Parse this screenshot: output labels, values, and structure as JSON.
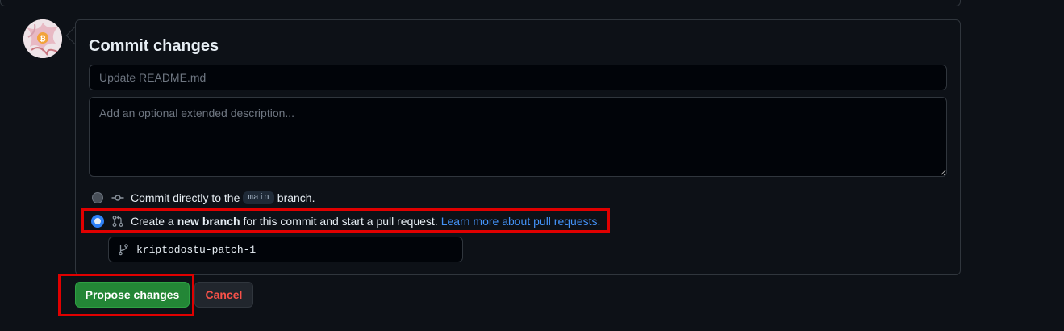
{
  "commit": {
    "title": "Commit changes",
    "summary_placeholder": "Update README.md",
    "summary_value": "",
    "description_placeholder": "Add an optional extended description...",
    "description_value": ""
  },
  "options": {
    "direct": {
      "text_before": "Commit directly to the",
      "branch": "main",
      "text_after": "branch.",
      "selected": false,
      "icon": "git-commit-icon"
    },
    "new_branch": {
      "text_before": "Create a",
      "bold": "new branch",
      "text_after": "for this commit and start a pull request.",
      "link": "Learn more about pull requests.",
      "selected": true,
      "icon": "git-pull-request-icon"
    }
  },
  "branch_name": {
    "value": "kriptodostu-patch-1",
    "icon": "git-branch-icon"
  },
  "buttons": {
    "propose": "Propose changes",
    "cancel": "Cancel"
  },
  "colors": {
    "background": "#0d1117",
    "border": "#30363d",
    "propose_bg": "#238636",
    "cancel_text": "#f85149",
    "link": "#4493f8",
    "annotation": "#e00000"
  }
}
